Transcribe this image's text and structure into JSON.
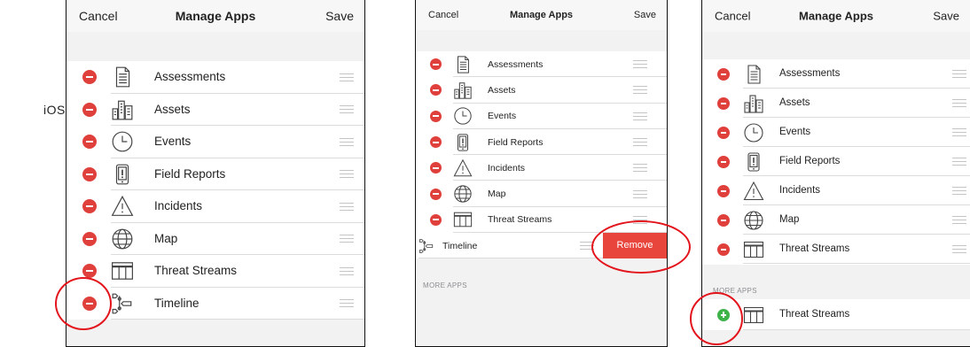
{
  "platform_label": "iOS",
  "nav": {
    "cancel": "Cancel",
    "title": "Manage Apps",
    "save": "Save"
  },
  "remove_label": "Remove",
  "more_apps_label": "MORE APPS",
  "panel1": {
    "items": [
      {
        "label": "Assessments",
        "icon": "assessment-icon"
      },
      {
        "label": "Assets",
        "icon": "buildings-icon"
      },
      {
        "label": "Events",
        "icon": "clock-icon"
      },
      {
        "label": "Field Reports",
        "icon": "field-report-icon"
      },
      {
        "label": "Incidents",
        "icon": "warning-triangle-icon"
      },
      {
        "label": "Map",
        "icon": "globe-icon"
      },
      {
        "label": "Threat Streams",
        "icon": "table-icon"
      },
      {
        "label": "Timeline",
        "icon": "timeline-icon"
      }
    ]
  },
  "panel2": {
    "items": [
      {
        "label": "Assessments",
        "icon": "assessment-icon"
      },
      {
        "label": "Assets",
        "icon": "buildings-icon"
      },
      {
        "label": "Events",
        "icon": "clock-icon"
      },
      {
        "label": "Field Reports",
        "icon": "field-report-icon"
      },
      {
        "label": "Incidents",
        "icon": "warning-triangle-icon"
      },
      {
        "label": "Map",
        "icon": "globe-icon"
      },
      {
        "label": "Threat Streams",
        "icon": "table-icon"
      }
    ],
    "swiped_item": {
      "label": "Timeline",
      "icon": "timeline-icon"
    }
  },
  "panel3": {
    "items": [
      {
        "label": "Assessments",
        "icon": "assessment-icon"
      },
      {
        "label": "Assets",
        "icon": "buildings-icon"
      },
      {
        "label": "Events",
        "icon": "clock-icon"
      },
      {
        "label": "Field Reports",
        "icon": "field-report-icon"
      },
      {
        "label": "Incidents",
        "icon": "warning-triangle-icon"
      },
      {
        "label": "Map",
        "icon": "globe-icon"
      },
      {
        "label": "Threat Streams",
        "icon": "table-icon"
      }
    ],
    "more_apps": [
      {
        "label": "Threat Streams",
        "icon": "table-icon"
      }
    ]
  },
  "colors": {
    "delete": "#e0403b",
    "add": "#3db34a",
    "remove_button": "#e8453c",
    "highlight_circle": "#e3141b"
  }
}
